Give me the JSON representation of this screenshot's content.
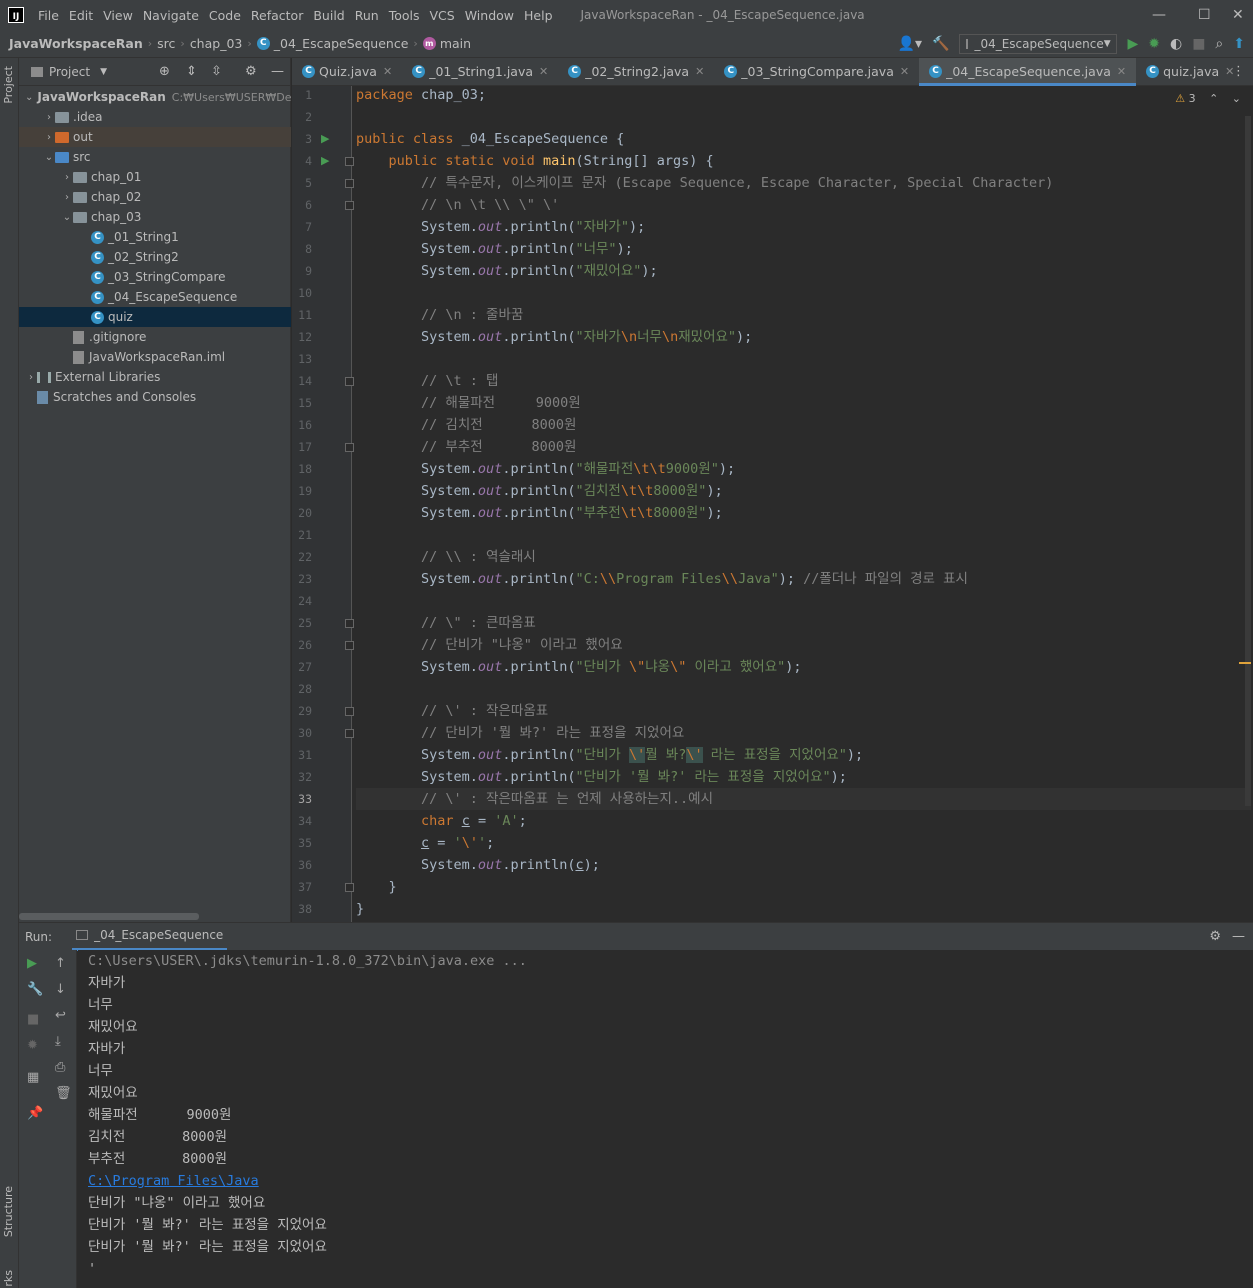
{
  "titlebar": {
    "logo_text": "IJ",
    "menu": [
      "File",
      "Edit",
      "View",
      "Navigate",
      "Code",
      "Refactor",
      "Build",
      "Run",
      "Tools",
      "VCS",
      "Window",
      "Help"
    ],
    "window_title": "JavaWorkspaceRan - _04_EscapeSequence.java"
  },
  "breadcrumbs": {
    "project": "JavaWorkspaceRan",
    "items": [
      "src",
      "chap_03",
      "_04_EscapeSequence",
      "main"
    ],
    "run_config": "_04_EscapeSequence"
  },
  "project_panel": {
    "title": "Project",
    "tree": [
      {
        "label": "JavaWorkspaceRan",
        "path": "C:₩Users₩USER₩Desktop₩JavaWorkspaceRan",
        "kind": "project",
        "indent": 0,
        "arrow": "down"
      },
      {
        "label": ".idea",
        "kind": "folder",
        "indent": 1,
        "arrow": "right"
      },
      {
        "label": "out",
        "kind": "folder-out",
        "indent": 1,
        "arrow": "right"
      },
      {
        "label": "src",
        "kind": "folder-src",
        "indent": 1,
        "arrow": "down"
      },
      {
        "label": "chap_01",
        "kind": "package",
        "indent": 2,
        "arrow": "right"
      },
      {
        "label": "chap_02",
        "kind": "package",
        "indent": 2,
        "arrow": "right"
      },
      {
        "label": "chap_03",
        "kind": "package",
        "indent": 2,
        "arrow": "down"
      },
      {
        "label": "_01_String1",
        "kind": "class",
        "indent": 3,
        "arrow": ""
      },
      {
        "label": "_02_String2",
        "kind": "class",
        "indent": 3,
        "arrow": ""
      },
      {
        "label": "_03_StringCompare",
        "kind": "class",
        "indent": 3,
        "arrow": ""
      },
      {
        "label": "_04_EscapeSequence",
        "kind": "class",
        "indent": 3,
        "arrow": ""
      },
      {
        "label": "quiz",
        "kind": "class",
        "indent": 3,
        "arrow": "",
        "selected": true
      },
      {
        "label": ".gitignore",
        "kind": "file",
        "indent": 2,
        "arrow": ""
      },
      {
        "label": "JavaWorkspaceRan.iml",
        "kind": "file",
        "indent": 2,
        "arrow": ""
      },
      {
        "label": "External Libraries",
        "kind": "lib",
        "indent": 0,
        "arrow": "right"
      },
      {
        "label": "Scratches and Consoles",
        "kind": "scratch",
        "indent": 0,
        "arrow": ""
      }
    ]
  },
  "tabs": [
    {
      "label": "Quiz.java",
      "active": false
    },
    {
      "label": "_01_String1.java",
      "active": false
    },
    {
      "label": "_02_String2.java",
      "active": false
    },
    {
      "label": "_03_StringCompare.java",
      "active": false
    },
    {
      "label": "_04_EscapeSequence.java",
      "active": true
    },
    {
      "label": "quiz.java",
      "active": false
    }
  ],
  "editor": {
    "warning_count": "3",
    "current_line": 33,
    "lines": [
      {
        "n": 1,
        "html": "<span class=\"kw\">package</span> chap_03;"
      },
      {
        "n": 2,
        "html": ""
      },
      {
        "n": 3,
        "html": "<span class=\"kw\">public class</span> _04_EscapeSequence {"
      },
      {
        "n": 4,
        "html": "    <span class=\"kw\">public static void</span> <span class=\"fn\">main</span>(String[] args) {"
      },
      {
        "n": 5,
        "html": "        <span class=\"cm\">// 특수문자, 이스케이프 문자 (Escape Sequence, Escape Character, Special Character)</span>"
      },
      {
        "n": 6,
        "html": "        <span class=\"cm\">// \\n \\t \\\\ \\\" \\'</span>"
      },
      {
        "n": 7,
        "html": "        System.<span class=\"ital\">out</span>.println(<span class=\"str\">\"자바가\"</span>);"
      },
      {
        "n": 8,
        "html": "        System.<span class=\"ital\">out</span>.println(<span class=\"str\">\"너무\"</span>);"
      },
      {
        "n": 9,
        "html": "        System.<span class=\"ital\">out</span>.println(<span class=\"str\">\"재밌어요\"</span>);"
      },
      {
        "n": 10,
        "html": ""
      },
      {
        "n": 11,
        "html": "        <span class=\"cm\">// \\n : 줄바꿈</span>"
      },
      {
        "n": 12,
        "html": "        System.<span class=\"ital\">out</span>.println(<span class=\"str\">\"자바가<span class=\"esc\">\\n</span>너무<span class=\"esc\">\\n</span>재밌어요\"</span>);"
      },
      {
        "n": 13,
        "html": ""
      },
      {
        "n": 14,
        "html": "        <span class=\"cm\">// \\t : 탭</span>"
      },
      {
        "n": 15,
        "html": "        <span class=\"cm\">// 해물파전     9000원</span>"
      },
      {
        "n": 16,
        "html": "        <span class=\"cm\">// 김치전      8000원</span>"
      },
      {
        "n": 17,
        "html": "        <span class=\"cm\">// 부추전      8000원</span>"
      },
      {
        "n": 18,
        "html": "        System.<span class=\"ital\">out</span>.println(<span class=\"str\">\"해물파전<span class=\"esc\">\\t\\t</span>9000원\"</span>);"
      },
      {
        "n": 19,
        "html": "        System.<span class=\"ital\">out</span>.println(<span class=\"str\">\"김치전<span class=\"esc\">\\t\\t</span>8000원\"</span>);"
      },
      {
        "n": 20,
        "html": "        System.<span class=\"ital\">out</span>.println(<span class=\"str\">\"부추전<span class=\"esc\">\\t\\t</span>8000원\"</span>);"
      },
      {
        "n": 21,
        "html": ""
      },
      {
        "n": 22,
        "html": "        <span class=\"cm\">// \\\\ : 역슬래시</span>"
      },
      {
        "n": 23,
        "html": "        System.<span class=\"ital\">out</span>.println(<span class=\"str\">\"C:<span class=\"esc\">\\\\</span>Program Files<span class=\"esc\">\\\\</span>Java\"</span>); <span class=\"cm\">//폴더나 파일의 경로 표시</span>"
      },
      {
        "n": 24,
        "html": ""
      },
      {
        "n": 25,
        "html": "        <span class=\"cm\">// \\\" : 큰따옴표</span>"
      },
      {
        "n": 26,
        "html": "        <span class=\"cm\">// 단비가 \"냐옹\" 이라고 했어요</span>"
      },
      {
        "n": 27,
        "html": "        System.<span class=\"ital\">out</span>.println(<span class=\"str\">\"단비가 <span class=\"esc\">\\\"</span>냐옹<span class=\"esc\">\\\"</span> 이라고 했어요\"</span>);"
      },
      {
        "n": 28,
        "html": ""
      },
      {
        "n": 29,
        "html": "        <span class=\"cm\">// \\' : 작은따옴표</span>"
      },
      {
        "n": 30,
        "html": "        <span class=\"cm\">// 단비가 '뭘 봐?' 라는 표정을 지었어요</span>"
      },
      {
        "n": 31,
        "html": "        System.<span class=\"ital\">out</span>.println(<span class=\"str\">\"단비가 <span class=\"esc hl\">\\'</span>뭘 봐?<span class=\"esc hl\">\\'</span> 라는 표정을 지었어요\"</span>);"
      },
      {
        "n": 32,
        "html": "        System.<span class=\"ital\">out</span>.println(<span class=\"str\">\"단비가 '뭘 봐?' 라는 표정을 지었어요\"</span>);"
      },
      {
        "n": 33,
        "html": "        <span class=\"cm\">// \\' : 작은따옴표 는 언제 사용하는지..예시</span>"
      },
      {
        "n": 34,
        "html": "        <span class=\"kw\">char</span> <span class=\"und\">c</span> = <span class=\"str\">'A'</span>;"
      },
      {
        "n": 35,
        "html": "        <span class=\"und\">c</span> = <span class=\"str\">'<span class=\"esc\">\\'</span>'</span>;"
      },
      {
        "n": 36,
        "html": "        System.<span class=\"ital\">out</span>.println(<span class=\"und\">c</span>);"
      },
      {
        "n": 37,
        "html": "    }"
      },
      {
        "n": 38,
        "html": "}"
      }
    ]
  },
  "run_panel": {
    "label": "Run:",
    "tab": "_04_EscapeSequence",
    "console": [
      {
        "text": "C:\\Users\\USER\\.jdks\\temurin-1.8.0_372\\bin\\java.exe ...",
        "kind": "cmd"
      },
      {
        "text": "자바가",
        "kind": "out"
      },
      {
        "text": "너무",
        "kind": "out"
      },
      {
        "text": "재밌어요",
        "kind": "out"
      },
      {
        "text": "자바가",
        "kind": "out"
      },
      {
        "text": "너무",
        "kind": "out"
      },
      {
        "text": "재밌어요",
        "kind": "out"
      },
      {
        "text": "해물파전      9000원",
        "kind": "out"
      },
      {
        "text": "김치전       8000원",
        "kind": "out"
      },
      {
        "text": "부추전       8000원",
        "kind": "out"
      },
      {
        "text": "C:\\Program Files\\Java",
        "kind": "link"
      },
      {
        "text": "단비가 \"냐옹\" 이라고 했어요",
        "kind": "out"
      },
      {
        "text": "단비가 '뭘 봐?' 라는 표정을 지었어요",
        "kind": "out"
      },
      {
        "text": "단비가 '뭘 봐?' 라는 표정을 지었어요",
        "kind": "out"
      },
      {
        "text": "'",
        "kind": "out"
      }
    ]
  },
  "side_stripe": {
    "project_label": "Project",
    "structure_label": "Structure",
    "bookmarks_label": "rks"
  }
}
